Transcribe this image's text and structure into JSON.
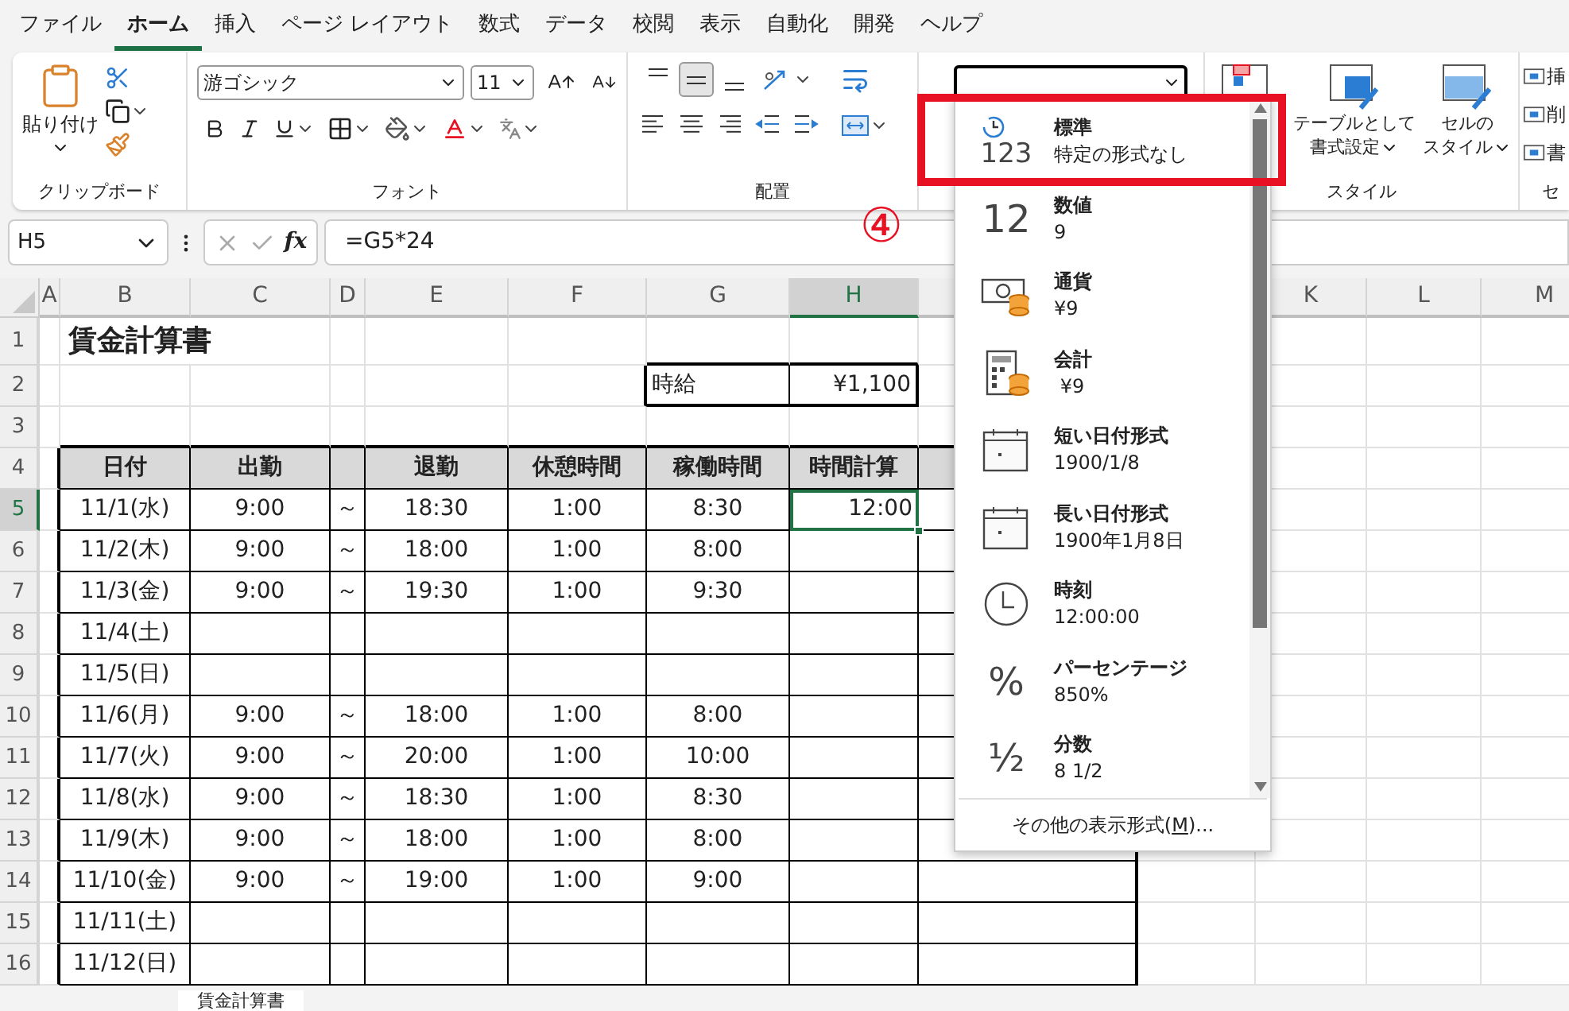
{
  "menu_tabs": [
    {
      "label": "ファイル",
      "selected": false
    },
    {
      "label": "ホーム",
      "selected": true
    },
    {
      "label": "挿入",
      "selected": false
    },
    {
      "label": "ページ レイアウト",
      "selected": false
    },
    {
      "label": "数式",
      "selected": false
    },
    {
      "label": "データ",
      "selected": false
    },
    {
      "label": "校閲",
      "selected": false
    },
    {
      "label": "表示",
      "selected": false
    },
    {
      "label": "自動化",
      "selected": false
    },
    {
      "label": "開発",
      "selected": false
    },
    {
      "label": "ヘルプ",
      "selected": false
    }
  ],
  "ribbon": {
    "clipboard": {
      "paste": "貼り付け",
      "label": "クリップボード"
    },
    "font": {
      "name": "游ゴシック",
      "size": "11",
      "label": "フォント"
    },
    "alignment": {
      "vertical_buttons": [
        {
          "selected": false
        },
        {
          "selected": true
        },
        {
          "selected": false
        }
      ],
      "label": "配置"
    },
    "styles": {
      "format_as_table": [
        "テーブルとして",
        "書式設定"
      ],
      "cell_styles": [
        "セルの",
        "スタイル"
      ],
      "label": "スタイル"
    },
    "cells": {
      "items": [
        "挿",
        "削",
        "書"
      ],
      "label": "セ"
    }
  },
  "formula_bar": {
    "name_box": "H5",
    "function_label": "fx",
    "formula": "=G5*24"
  },
  "step_marker": "④",
  "sheet": {
    "column_headers": [
      {
        "label": "A",
        "selected": false
      },
      {
        "label": "B",
        "selected": false
      },
      {
        "label": "C",
        "selected": false
      },
      {
        "label": "D",
        "selected": false
      },
      {
        "label": "E",
        "selected": false
      },
      {
        "label": "F",
        "selected": false
      },
      {
        "label": "G",
        "selected": false
      },
      {
        "label": "H",
        "selected": true
      },
      {
        "label": "K",
        "selected": false
      },
      {
        "label": "L",
        "selected": false
      },
      {
        "label": "M",
        "selected": false
      }
    ],
    "row_headers": [
      {
        "label": "1",
        "selected": false
      },
      {
        "label": "2",
        "selected": false
      },
      {
        "label": "3",
        "selected": false
      },
      {
        "label": "4",
        "selected": false
      },
      {
        "label": "5",
        "selected": true
      },
      {
        "label": "6",
        "selected": false
      },
      {
        "label": "7",
        "selected": false
      },
      {
        "label": "8",
        "selected": false
      },
      {
        "label": "9",
        "selected": false
      },
      {
        "label": "10",
        "selected": false
      },
      {
        "label": "11",
        "selected": false
      },
      {
        "label": "12",
        "selected": false
      },
      {
        "label": "13",
        "selected": false
      },
      {
        "label": "14",
        "selected": false
      },
      {
        "label": "15",
        "selected": false
      },
      {
        "label": "16",
        "selected": false
      }
    ],
    "title": "賃金計算書",
    "rate_label": "時給",
    "rate_value": "¥1,100",
    "table_header": [
      "日付",
      "出勤",
      "退勤",
      "休憩時間",
      "稼働時間",
      "時間計算"
    ],
    "rows": [
      {
        "date": "11/1(水)",
        "start": "9:00",
        "tilde": "～",
        "end": "18:30",
        "break": "1:00",
        "worked": "8:30",
        "calc": {
          "text": "12:00",
          "selected": true
        }
      },
      {
        "date": "11/2(木)",
        "start": "9:00",
        "tilde": "～",
        "end": "18:00",
        "break": "1:00",
        "worked": "8:00",
        "calc": {
          "selected": false
        }
      },
      {
        "date": "11/3(金)",
        "start": "9:00",
        "tilde": "～",
        "end": "19:30",
        "break": "1:00",
        "worked": "9:30",
        "calc": {
          "selected": false
        }
      },
      {
        "date": "11/4(土)",
        "calc": {
          "selected": false
        }
      },
      {
        "date": "11/5(日)",
        "calc": {
          "selected": false
        }
      },
      {
        "date": "11/6(月)",
        "start": "9:00",
        "tilde": "～",
        "end": "18:00",
        "break": "1:00",
        "worked": "8:00",
        "calc": {
          "selected": false
        }
      },
      {
        "date": "11/7(火)",
        "start": "9:00",
        "tilde": "～",
        "end": "20:00",
        "break": "1:00",
        "worked": "10:00",
        "calc": {
          "selected": false
        }
      },
      {
        "date": "11/8(水)",
        "start": "9:00",
        "tilde": "～",
        "end": "18:30",
        "break": "1:00",
        "worked": "8:30",
        "calc": {
          "selected": false
        }
      },
      {
        "date": "11/9(木)",
        "start": "9:00",
        "tilde": "～",
        "end": "18:00",
        "break": "1:00",
        "worked": "8:00",
        "calc": {
          "selected": false
        }
      },
      {
        "date": "11/10(金)",
        "start": "9:00",
        "tilde": "～",
        "end": "19:00",
        "break": "1:00",
        "worked": "9:00",
        "calc": {
          "selected": false
        }
      },
      {
        "date": "11/11(土)",
        "calc": {
          "selected": false
        }
      },
      {
        "date": "11/12(日)",
        "calc": {
          "selected": false
        }
      }
    ]
  },
  "format_menu": {
    "items": [
      {
        "kind": "general",
        "glyph": "123",
        "name": "標準",
        "example": "特定の形式なし",
        "highlighted": true
      },
      {
        "kind": "number",
        "glyph": "12",
        "name": "数値",
        "example": "9",
        "highlighted": false
      },
      {
        "kind": "currency",
        "name": "通貨",
        "example": "¥9",
        "highlighted": false
      },
      {
        "kind": "accounting",
        "name": "会計",
        "example": " ¥9",
        "highlighted": false
      },
      {
        "kind": "date",
        "name": "短い日付形式",
        "example": "1900/1/8",
        "highlighted": false
      },
      {
        "kind": "date",
        "name": "長い日付形式",
        "example": "1900年1月8日",
        "highlighted": false
      },
      {
        "kind": "time",
        "name": "時刻",
        "example": "12:00:00",
        "highlighted": false
      },
      {
        "kind": "percent",
        "glyph": "%",
        "name": "パーセンテージ",
        "example": "850%",
        "highlighted": false
      },
      {
        "kind": "fraction",
        "glyph": "½",
        "name": "分数",
        "example": "8 1/2",
        "highlighted": false
      }
    ],
    "more": {
      "before": "その他の表示形式(",
      "key": "M",
      "after": ")..."
    }
  },
  "sheet_tab": {
    "label": "賃金計算書"
  }
}
